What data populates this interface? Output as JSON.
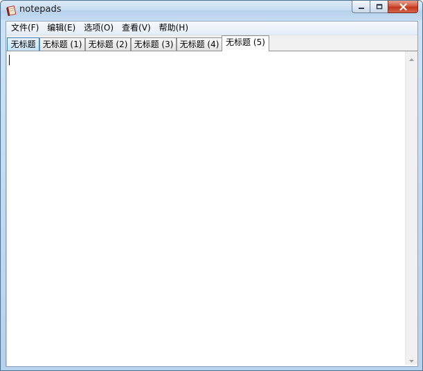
{
  "window": {
    "title": "notepads",
    "icons": {
      "app": "notebook-icon",
      "minimize": "minimize-icon",
      "maximize": "maximize-icon",
      "close": "close-icon"
    }
  },
  "menu": {
    "items": [
      {
        "label": "文件(F)"
      },
      {
        "label": "编辑(E)"
      },
      {
        "label": "选项(O)"
      },
      {
        "label": "查看(V)"
      },
      {
        "label": "帮助(H)"
      }
    ]
  },
  "tabs": [
    {
      "label": "无标题",
      "state": "hover"
    },
    {
      "label": "无标题 (1)",
      "state": "normal"
    },
    {
      "label": "无标题 (2)",
      "state": "normal"
    },
    {
      "label": "无标题 (3)",
      "state": "normal"
    },
    {
      "label": "无标题 (4)",
      "state": "normal"
    },
    {
      "label": "无标题 (5)",
      "state": "active"
    }
  ],
  "editor": {
    "content": ""
  },
  "colors": {
    "title_bar": "#c6dcf1",
    "close_button": "#c2371c",
    "tab_hover": "#c4e2f8",
    "editor_background": "#ffffff"
  }
}
